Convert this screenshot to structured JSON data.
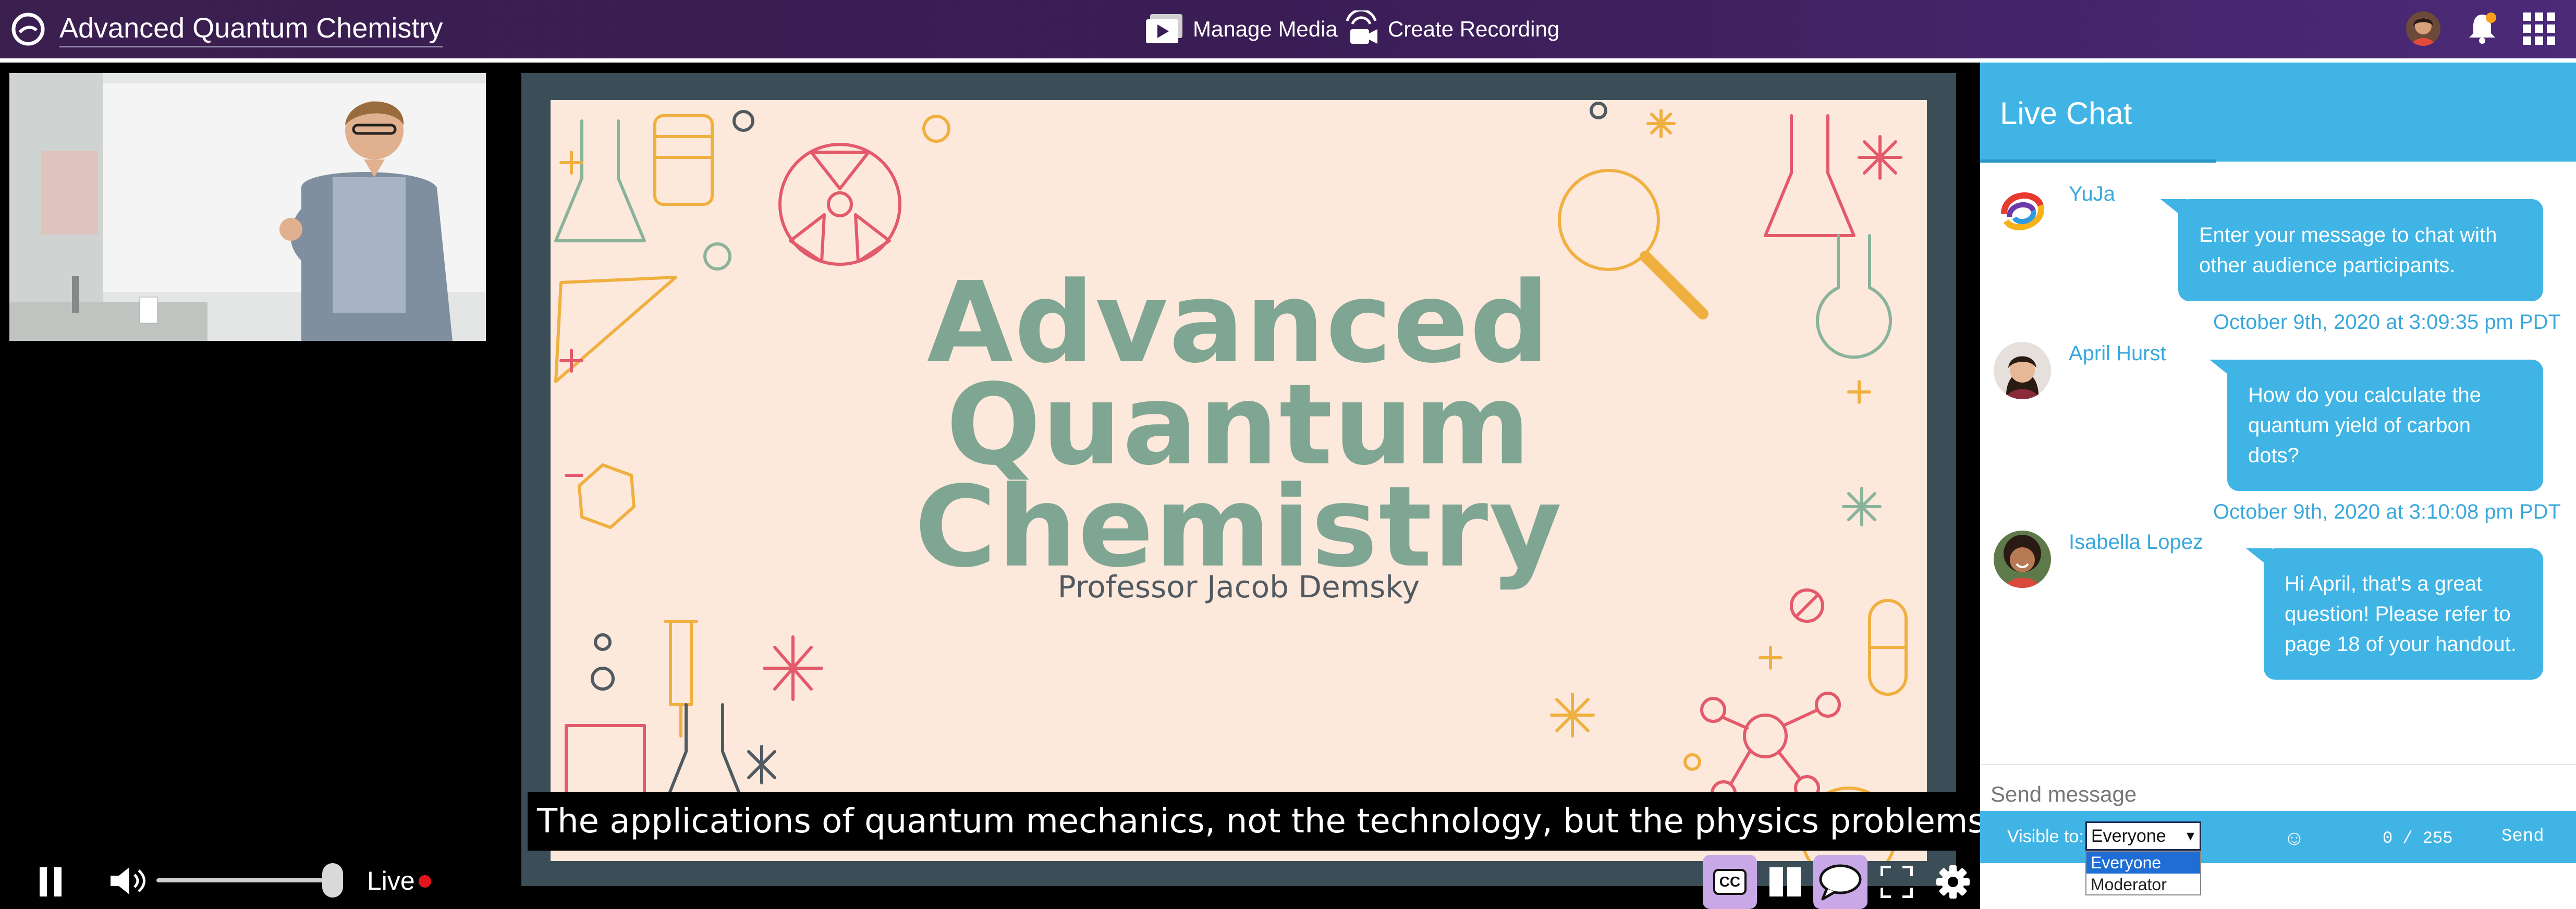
{
  "app": {
    "title": "Advanced Quantum Chemistry"
  },
  "topbar": {
    "manage_media_label": "Manage Media",
    "create_recording_label": "Create Recording"
  },
  "slide": {
    "title": "Advanced\nQuantum\nChemistry",
    "subtitle": "Professor Jacob Demsky"
  },
  "caption": "The applications of quantum mechanics, not the technology, but the physics problems.",
  "player": {
    "live_label": "Live",
    "volume_level": 0.97,
    "cc_label": "CC"
  },
  "chat": {
    "title": "Live Chat",
    "messages": [
      {
        "name": "YuJa",
        "text": "Enter your message to chat with other audience participants.",
        "time": "October 9th, 2020 at 3:09:35 pm PDT"
      },
      {
        "name": "April Hurst",
        "text": "How do you calculate the quantum yield of carbon dots?",
        "time": "October 9th, 2020 at 3:10:08 pm PDT"
      },
      {
        "name": "Isabella Lopez",
        "text": "Hi April, that's a great question! Please refer to page 18 of your handout.",
        "time": ""
      }
    ],
    "send_placeholder": "Send message",
    "visible_to_label": "Visible to:",
    "visible_to_selected": "Everyone",
    "visible_to_options": [
      "Everyone",
      "Moderator"
    ],
    "counter": "0 / 255",
    "send_label": "Send"
  },
  "colors": {
    "topbar": "#3a1d55",
    "chat_accent": "#3fb4e5",
    "slide_bg": "#fde8dc",
    "slide_title": "#7fa692",
    "live_dot": "#e3151a"
  }
}
